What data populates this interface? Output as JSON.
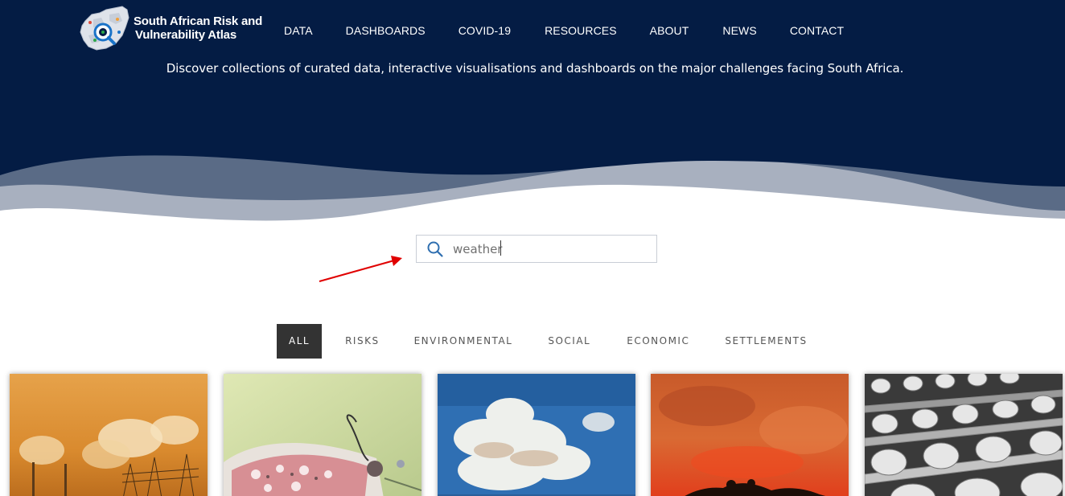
{
  "header": {
    "logo_line1": "South African Risk and",
    "logo_line2": "Vulnerability Atlas",
    "nav": [
      {
        "label": "DATA"
      },
      {
        "label": "DASHBOARDS"
      },
      {
        "label": "COVID-19"
      },
      {
        "label": "RESOURCES"
      },
      {
        "label": "ABOUT"
      },
      {
        "label": "NEWS"
      },
      {
        "label": "CONTACT"
      }
    ],
    "tagline": "Discover collections of curated data, interactive visualisations and dashboards on the major challenges facing South Africa."
  },
  "search": {
    "value": "weather",
    "icon": "search-icon"
  },
  "filters": [
    {
      "label": "ALL",
      "active": true
    },
    {
      "label": "RISKS"
    },
    {
      "label": "ENVIRONMENTAL"
    },
    {
      "label": "SOCIAL"
    },
    {
      "label": "ECONOMIC"
    },
    {
      "label": "SETTLEMENTS"
    }
  ],
  "cards": [
    {
      "image": "industrial-smoke-stacks-at-sunset"
    },
    {
      "image": "butterfly-on-flower"
    },
    {
      "image": "clouds-in-blue-sky"
    },
    {
      "image": "wildfire-red-sky"
    },
    {
      "image": "empty-lecture-hall-chairs"
    }
  ],
  "colors": {
    "header_bg": "#041c44",
    "wave_mid": "#5a6b86",
    "wave_light": "#a8b0bf",
    "filter_active_bg": "#333333",
    "annotation_arrow": "#e00000"
  }
}
